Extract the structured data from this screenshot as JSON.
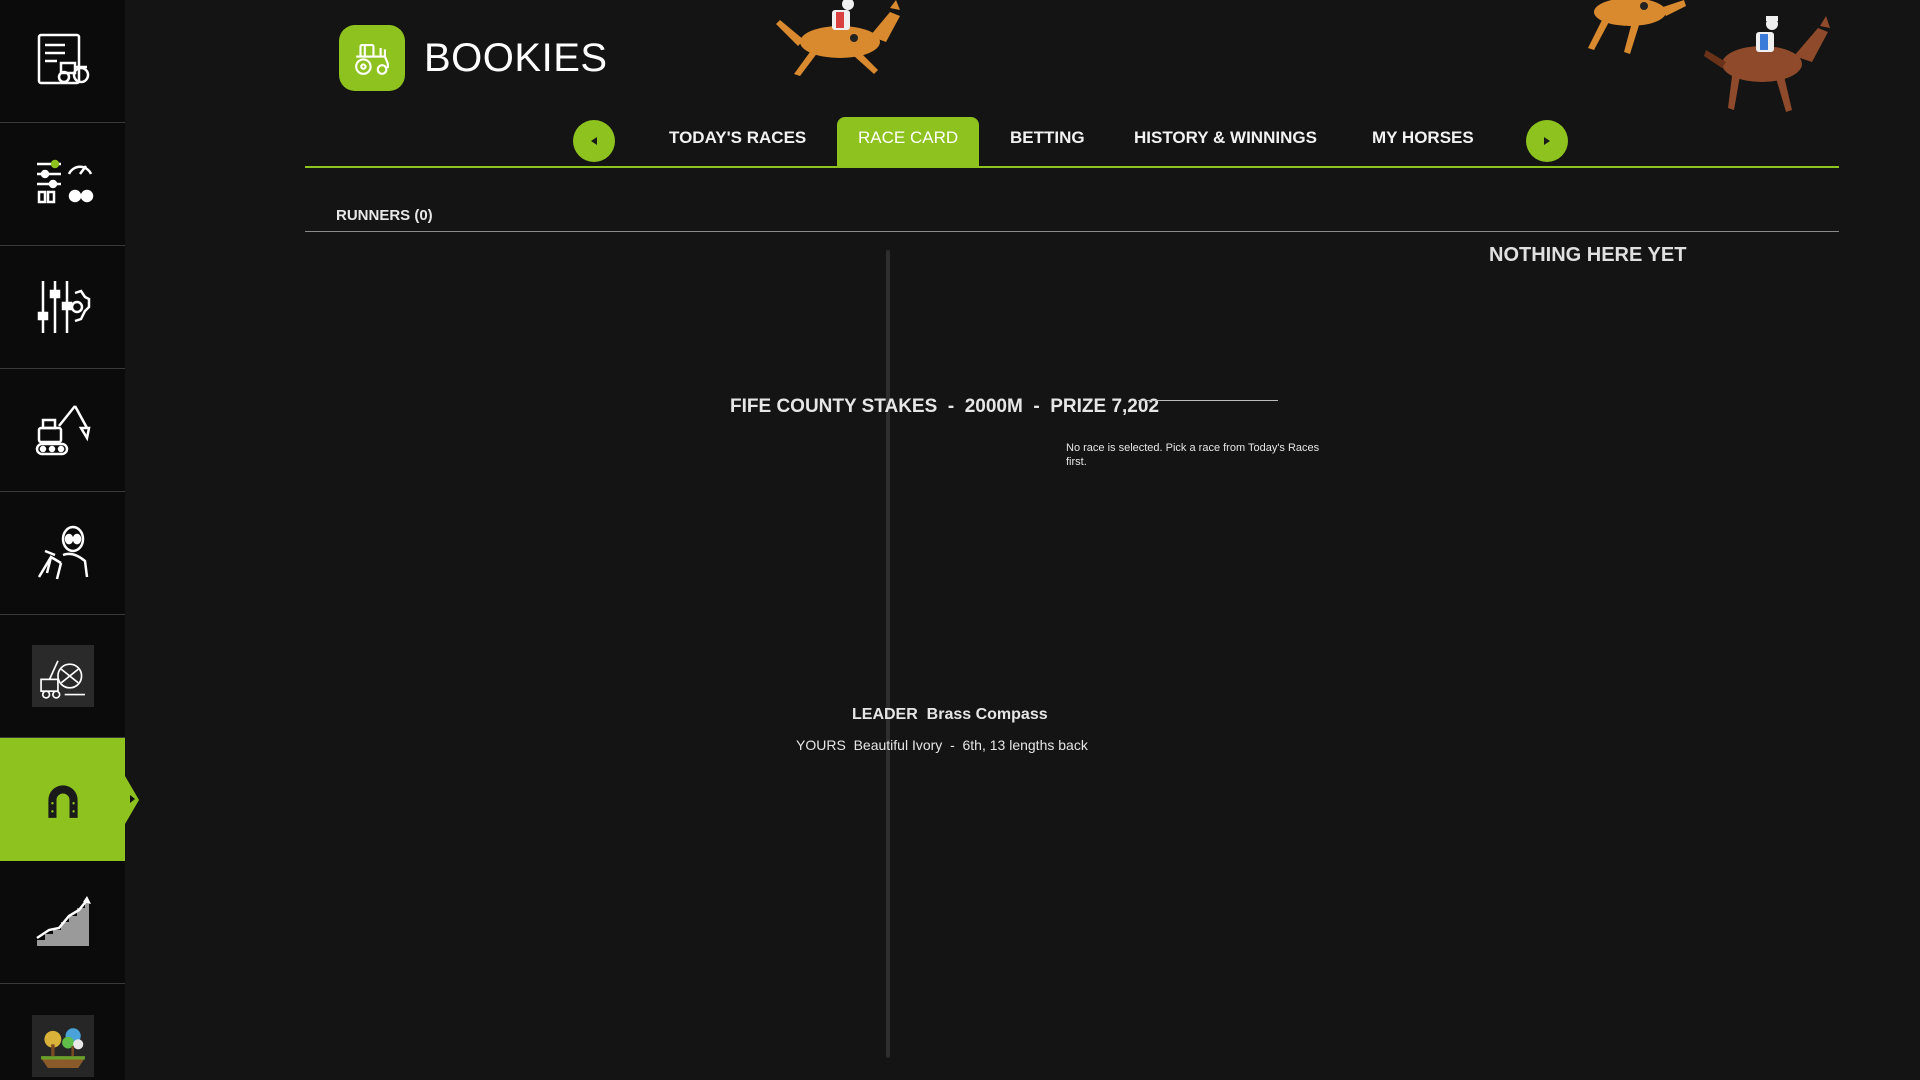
{
  "header": {
    "title": "BOOKIES",
    "logo_icon": "tractor-icon"
  },
  "sidebar": {
    "items": [
      {
        "icon": "vehicle-list-icon",
        "active": false
      },
      {
        "icon": "settings-sliders-gauge-icon",
        "active": false
      },
      {
        "icon": "sliders-gear-icon",
        "active": false
      },
      {
        "icon": "excavator-icon",
        "active": false
      },
      {
        "icon": "alien-figure-icon",
        "active": false
      },
      {
        "icon": "logging-machine-icon",
        "active": false
      },
      {
        "icon": "horseshoe-icon",
        "active": true
      },
      {
        "icon": "rising-chart-icon",
        "active": false
      },
      {
        "icon": "landscape-tree-icon",
        "active": false
      }
    ]
  },
  "tabs": {
    "items": [
      {
        "label": "TODAY'S RACES",
        "active": false
      },
      {
        "label": "RACE CARD",
        "active": true
      },
      {
        "label": "BETTING",
        "active": false
      },
      {
        "label": "HISTORY & WINNINGS",
        "active": false
      },
      {
        "label": "MY HORSES",
        "active": false
      }
    ]
  },
  "runners": {
    "label": "RUNNERS (0)",
    "empty_text": "NOTHING HERE YET"
  },
  "race": {
    "title": "FIFE COUNTY STAKES  -  2000M  -  PRIZE 7,202",
    "message": "No race is selected. Pick a race from Today's Races first.",
    "leader_label": "LEADER",
    "leader_name": "Brass Compass",
    "yours_label": "YOURS",
    "yours_detail": "Beautiful Ivory  -  6th, 13 lengths back"
  },
  "colors": {
    "accent": "#8dc21f",
    "background": "#141414",
    "sidebar": "#0b0b0b"
  }
}
